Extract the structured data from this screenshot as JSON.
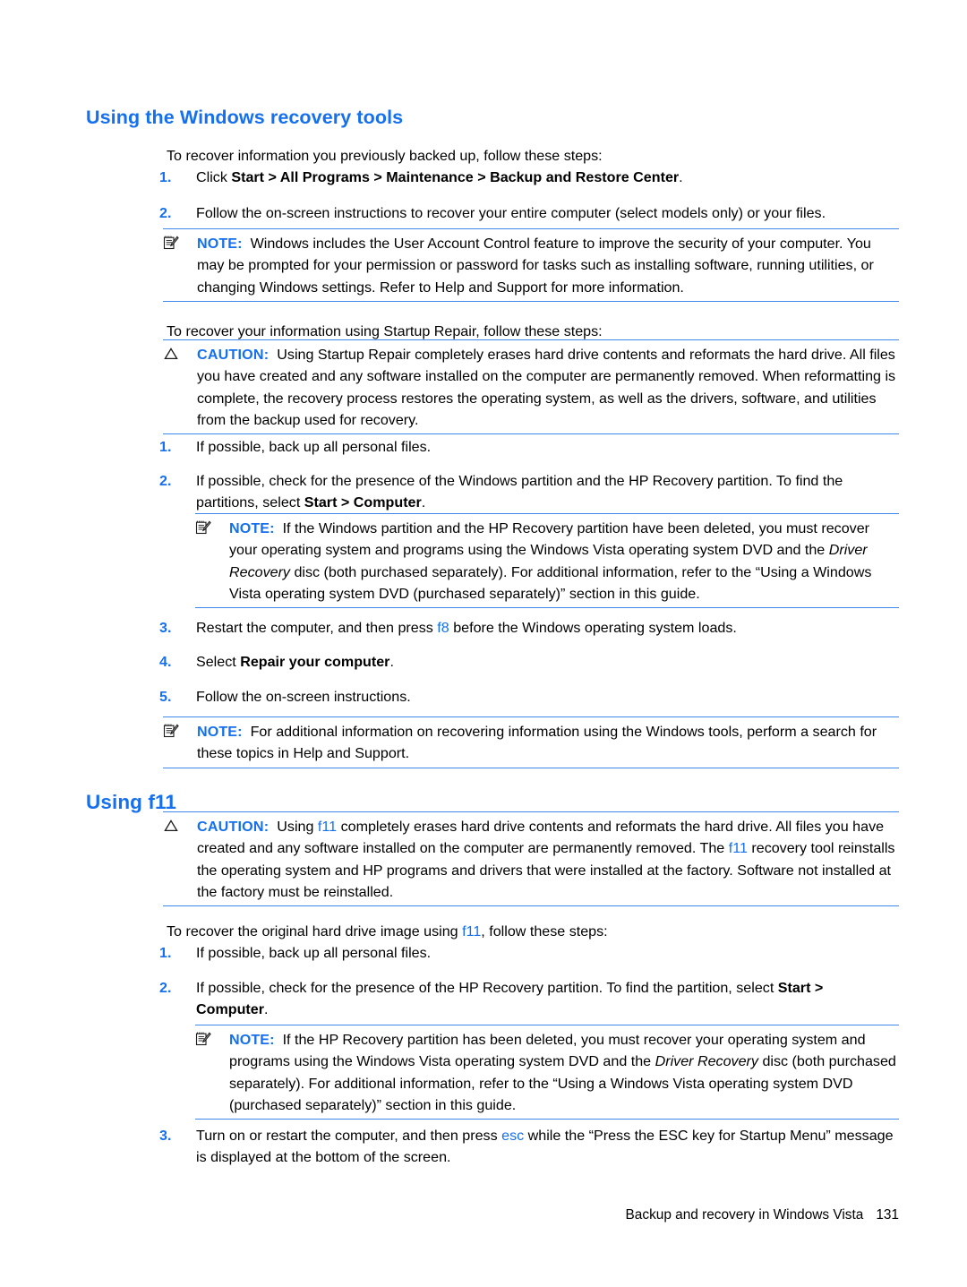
{
  "page": {
    "document_type": "user-guide-page",
    "footer_text": "Backup and recovery in Windows Vista",
    "page_number": "131",
    "accent_color": "#1570ef",
    "rule_color": "#3f87e8"
  },
  "sections": [
    {
      "id": "windows-recovery-tools",
      "heading": "Using the Windows recovery tools"
    },
    {
      "id": "using-f11",
      "heading": "Using f11"
    }
  ],
  "content": {
    "intro_para": "To recover information you previously backed up, follow these steps:",
    "step1": {
      "number": "1.",
      "pre": "Click ",
      "bold": "Start > All Programs > Maintenance > Backup and Restore Center",
      "post": "."
    },
    "step2": {
      "number": "2.",
      "text": "Follow the on-screen instructions to recover your entire computer (select models only) or your files."
    },
    "note1": {
      "label": "NOTE:",
      "icon": "note-pad-icon",
      "text": "Windows includes the User Account Control feature to improve the security of your computer. You may be prompted for your permission or password for tasks such as installing software, running utilities, or changing Windows settings. Refer to Help and Support for more information."
    },
    "startup_repair_para": "To recover your information using Startup Repair, follow these steps:",
    "caution1": {
      "label": "CAUTION:",
      "icon": "warning-triangle-icon",
      "text": "Using Startup Repair completely erases hard drive contents and reformats the hard drive. All files you have created and any software installed on the computer are permanently removed. When reformatting is complete, the recovery process restores the operating system, as well as the drivers, software, and utilities from the backup used for recovery."
    },
    "sr_step1": {
      "number": "1.",
      "text": "If possible, back up all personal files."
    },
    "sr_step2": {
      "number": "2.",
      "pre": "If possible, check for the presence of the Windows partition and the HP Recovery partition. To find the partitions, select ",
      "bold": "Start > Computer",
      "post": "."
    },
    "note2": {
      "label": "NOTE:",
      "icon": "note-pad-icon",
      "pre": "If the Windows partition and the HP Recovery partition have been deleted, you must recover your operating system and programs using the Windows Vista operating system DVD and the ",
      "italic": "Driver Recovery",
      "post": " disc (both purchased separately). For additional information, refer to the “Using a Windows Vista operating system DVD (purchased separately)” section in this guide."
    },
    "sr_step3": {
      "number": "3.",
      "pre": "Restart the computer, and then press ",
      "key": "f8",
      "post": " before the Windows operating system loads."
    },
    "sr_step4": {
      "number": "4.",
      "pre": "Select ",
      "bold": "Repair your computer",
      "post": "."
    },
    "sr_step5": {
      "number": "5.",
      "text": "Follow the on-screen instructions."
    },
    "note3": {
      "label": "NOTE:",
      "icon": "note-pad-icon",
      "text": "For additional information on recovering information using the Windows tools, perform a search for these topics in Help and Support."
    },
    "caution2": {
      "label": "CAUTION:",
      "icon": "warning-triangle-icon",
      "pre": "Using ",
      "key1": "f11",
      "mid": " completely erases hard drive contents and reformats the hard drive. All files you have created and any software installed on the computer are permanently removed. The ",
      "key2": "f11",
      "post": " recovery tool reinstalls the operating system and HP programs and drivers that were installed at the factory. Software not installed at the factory must be reinstalled."
    },
    "f11_intro": {
      "pre": "To recover the original hard drive image using ",
      "key": "f11",
      "post": ", follow these steps:"
    },
    "f11_step1": {
      "number": "1.",
      "text": "If possible, back up all personal files."
    },
    "f11_step2": {
      "number": "2.",
      "pre": "If possible, check for the presence of the HP Recovery partition. To find the partition, select ",
      "bold": "Start > Computer",
      "post": "."
    },
    "note4": {
      "label": "NOTE:",
      "icon": "note-pad-icon",
      "pre": "If the HP Recovery partition has been deleted, you must recover your operating system and programs using the Windows Vista operating system DVD and the ",
      "italic": "Driver Recovery",
      "post": " disc (both purchased separately). For additional information, refer to the “Using a Windows Vista operating system DVD (purchased separately)” section in this guide."
    },
    "f11_step3": {
      "number": "3.",
      "pre": "Turn on or restart the computer, and then press ",
      "key": "esc",
      "post": " while the “Press the ESC key for Startup Menu” message is displayed at the bottom of the screen."
    }
  }
}
